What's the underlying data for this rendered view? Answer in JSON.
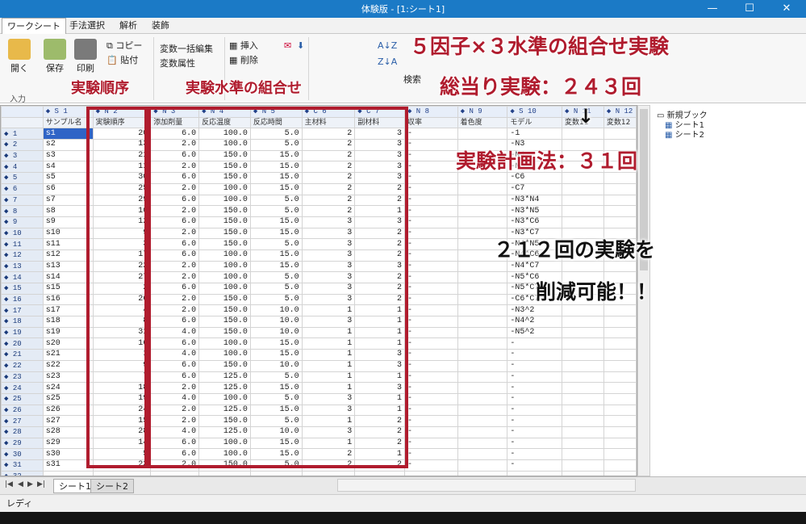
{
  "window": {
    "title": "体験版 - [1:シート1]",
    "min": "—",
    "max": "☐",
    "close": "✕"
  },
  "menu": [
    "ワークシート",
    "手法選択",
    "解析",
    "装飾"
  ],
  "ribbon": {
    "open": "開く",
    "save": "保存",
    "print": "印刷",
    "copy": "コピー",
    "paste": "貼付",
    "var_bulk_edit": "変数一括編集",
    "var_attr": "変数属性",
    "insert": "挿入",
    "delete": "削除",
    "search": "検索",
    "group_input": "入力"
  },
  "grid": {
    "col_ids": [
      "◆ S 1",
      "◆ N 2",
      "◆ N 3",
      "◆ N 4",
      "◆ N 5",
      "◆ C 6",
      "◆ C 7",
      "◆ N 8",
      "◆ N 9",
      "◆ S 10",
      "◆ N 11",
      "◆ N 12"
    ],
    "col_names": [
      "サンプル名",
      "実験順序",
      "添加剤量",
      "反応温度",
      "反応時間",
      "主材料",
      "副材料",
      "収率",
      "着色度",
      "モデル",
      "変数11",
      "変数12"
    ],
    "rows": [
      [
        "s1",
        "20",
        "6.0",
        "100.0",
        "5.0",
        "2",
        "3",
        "-",
        "",
        "-1"
      ],
      [
        "s2",
        "13",
        "2.0",
        "100.0",
        "5.0",
        "2",
        "3",
        "-",
        "",
        "-N3"
      ],
      [
        "s3",
        "21",
        "6.0",
        "150.0",
        "15.0",
        "2",
        "3",
        "-",
        "",
        "-N4"
      ],
      [
        "s4",
        "11",
        "2.0",
        "150.0",
        "15.0",
        "2",
        "3",
        "-",
        "",
        "-N5"
      ],
      [
        "s5",
        "30",
        "6.0",
        "150.0",
        "15.0",
        "2",
        "3",
        "-",
        "",
        "-C6"
      ],
      [
        "s6",
        "25",
        "2.0",
        "100.0",
        "15.0",
        "2",
        "2",
        "-",
        "",
        "-C7"
      ],
      [
        "s7",
        "29",
        "6.0",
        "100.0",
        "5.0",
        "2",
        "2",
        "-",
        "",
        "-N3*N4"
      ],
      [
        "s8",
        "10",
        "2.0",
        "150.0",
        "5.0",
        "2",
        "1",
        "-",
        "",
        "-N3*N5"
      ],
      [
        "s9",
        "12",
        "6.0",
        "150.0",
        "15.0",
        "3",
        "3",
        "-",
        "",
        "-N3*C6"
      ],
      [
        "s10",
        "9",
        "2.0",
        "150.0",
        "15.0",
        "3",
        "2",
        "-",
        "",
        "-N3*C7"
      ],
      [
        "s11",
        "3",
        "6.0",
        "150.0",
        "5.0",
        "3",
        "2",
        "-",
        "",
        "-N4*N5"
      ],
      [
        "s12",
        "17",
        "6.0",
        "100.0",
        "15.0",
        "3",
        "2",
        "-",
        "",
        "-N4*C6"
      ],
      [
        "s13",
        "22",
        "2.0",
        "100.0",
        "15.0",
        "3",
        "3",
        "-",
        "",
        "-N4*C7"
      ],
      [
        "s14",
        "27",
        "2.0",
        "100.0",
        "5.0",
        "3",
        "2",
        "-",
        "",
        "-N5*C6"
      ],
      [
        "s15",
        "2",
        "6.0",
        "100.0",
        "5.0",
        "3",
        "2",
        "-",
        "",
        "-N5*C7"
      ],
      [
        "s16",
        "26",
        "2.0",
        "150.0",
        "5.0",
        "3",
        "2",
        "-",
        "",
        "-C6*C7"
      ],
      [
        "s17",
        "4",
        "2.0",
        "150.0",
        "10.0",
        "1",
        "1",
        "-",
        "",
        "-N3^2"
      ],
      [
        "s18",
        "8",
        "6.0",
        "150.0",
        "10.0",
        "3",
        "1",
        "-",
        "",
        "-N4^2"
      ],
      [
        "s19",
        "31",
        "4.0",
        "150.0",
        "10.0",
        "1",
        "1",
        "-",
        "",
        "-N5^2"
      ],
      [
        "s20",
        "16",
        "6.0",
        "100.0",
        "15.0",
        "1",
        "1",
        "-",
        "",
        "-"
      ],
      [
        "s21",
        "1",
        "4.0",
        "100.0",
        "15.0",
        "1",
        "3",
        "-",
        "",
        "-"
      ],
      [
        "s22",
        "9",
        "6.0",
        "150.0",
        "10.0",
        "1",
        "3",
        "-",
        "",
        "-"
      ],
      [
        "s23",
        "7",
        "6.0",
        "125.0",
        "5.0",
        "1",
        "1",
        "-",
        "",
        "-"
      ],
      [
        "s24",
        "18",
        "2.0",
        "125.0",
        "15.0",
        "1",
        "3",
        "-",
        "",
        "-"
      ],
      [
        "s25",
        "19",
        "4.0",
        "100.0",
        "5.0",
        "3",
        "1",
        "-",
        "",
        "-"
      ],
      [
        "s26",
        "24",
        "2.0",
        "125.0",
        "15.0",
        "3",
        "1",
        "-",
        "",
        "-"
      ],
      [
        "s27",
        "15",
        "2.0",
        "150.0",
        "5.0",
        "1",
        "2",
        "-",
        "",
        "-"
      ],
      [
        "s28",
        "28",
        "4.0",
        "125.0",
        "10.0",
        "3",
        "2",
        "-",
        "",
        "-"
      ],
      [
        "s29",
        "14",
        "6.0",
        "100.0",
        "15.0",
        "1",
        "2",
        "-",
        "",
        "-"
      ],
      [
        "s30",
        "5",
        "6.0",
        "100.0",
        "15.0",
        "2",
        "1",
        "-",
        "",
        "-"
      ],
      [
        "s31",
        "23",
        "2.0",
        "150.0",
        "5.0",
        "2",
        "2",
        "-",
        "",
        "-"
      ]
    ],
    "extra_row": "32"
  },
  "tree": {
    "root": "新規ブック",
    "items": [
      "シート1",
      "シート2"
    ]
  },
  "tabs": [
    "シート1",
    "シート2"
  ],
  "status": "レディ",
  "annotations": {
    "order": "実験順序",
    "levels": "実験水準の組合せ",
    "title1": "５因子×３水準の組合せ実験",
    "title2": "総当り実験：２４３回",
    "arrow": "↓",
    "plan": "実験計画法：３１回",
    "save1": "２１２回の実験を",
    "save2": "削減可能！！"
  },
  "colors": {
    "titlebar": "#1b7ac6",
    "highlight": "#b01c2e",
    "selected": "#2f64c6"
  }
}
